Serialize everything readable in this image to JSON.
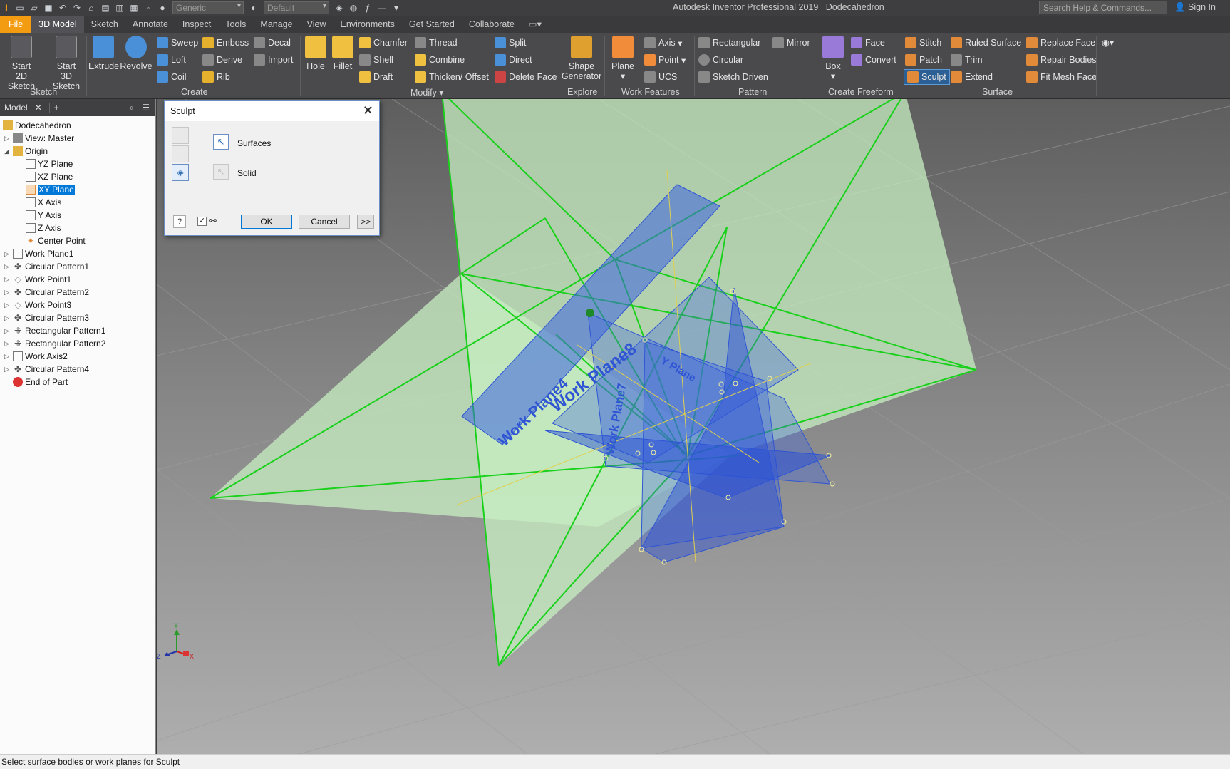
{
  "app": {
    "title": "Autodesk Inventor Professional 2019",
    "document": "Dodecahedron",
    "search_placeholder": "Search Help & Commands...",
    "sign_in": "Sign In",
    "material_combo": "Generic",
    "appearance_combo": "Default"
  },
  "tabs": [
    "File",
    "3D Model",
    "Sketch",
    "Annotate",
    "Inspect",
    "Tools",
    "Manage",
    "View",
    "Environments",
    "Get Started",
    "Collaborate"
  ],
  "ribbon": {
    "sketch": {
      "start2d_a": "Start",
      "start2d_b": "2D Sketch",
      "start3d_a": "Start",
      "start3d_b": "3D Sketch",
      "panel": "Sketch"
    },
    "create": {
      "extrude": "Extrude",
      "revolve": "Revolve",
      "sweep": "Sweep",
      "loft": "Loft",
      "coil": "Coil",
      "emboss": "Emboss",
      "derive": "Derive",
      "rib": "Rib",
      "decal": "Decal",
      "import": "Import",
      "panel": "Create"
    },
    "modify": {
      "hole": "Hole",
      "fillet": "Fillet",
      "chamfer": "Chamfer",
      "shell": "Shell",
      "draft": "Draft",
      "thread": "Thread",
      "combine": "Combine",
      "thicken": "Thicken/ Offset",
      "split": "Split",
      "direct": "Direct",
      "delete_face": "Delete Face",
      "panel": "Modify ▾"
    },
    "explore": {
      "shape_a": "Shape",
      "shape_b": "Generator",
      "panel": "Explore"
    },
    "work": {
      "plane": "Plane",
      "axis": "Axis",
      "point": "Point",
      "ucs": "UCS",
      "panel": "Work Features"
    },
    "pattern": {
      "rectangular": "Rectangular",
      "circular": "Circular",
      "sketch_driven": "Sketch Driven",
      "mirror": "Mirror",
      "panel": "Pattern"
    },
    "freeform": {
      "box": "Box",
      "face": "Face",
      "convert": "Convert",
      "panel": "Create Freeform"
    },
    "surface": {
      "stitch": "Stitch",
      "patch": "Patch",
      "sculpt": "Sculpt",
      "ruled": "Ruled Surface",
      "trim": "Trim",
      "extend": "Extend",
      "replace": "Replace Face",
      "repair": "Repair Bodies",
      "fit_mesh": "Fit Mesh Face",
      "panel": "Surface"
    }
  },
  "browser": {
    "tab": "Model",
    "items": [
      {
        "label": "Dodecahedron"
      },
      {
        "label": "View: Master"
      },
      {
        "label": "Origin"
      },
      {
        "label": "YZ Plane"
      },
      {
        "label": "XZ Plane"
      },
      {
        "label": "XY Plane"
      },
      {
        "label": "X Axis"
      },
      {
        "label": "Y Axis"
      },
      {
        "label": "Z Axis"
      },
      {
        "label": "Center Point"
      },
      {
        "label": "Work Plane1"
      },
      {
        "label": "Circular Pattern1"
      },
      {
        "label": "Work Point1"
      },
      {
        "label": "Circular Pattern2"
      },
      {
        "label": "Work Point3"
      },
      {
        "label": "Circular Pattern3"
      },
      {
        "label": "Rectangular Pattern1"
      },
      {
        "label": "Rectangular Pattern2"
      },
      {
        "label": "Work Axis2"
      },
      {
        "label": "Circular Pattern4"
      },
      {
        "label": "End of Part"
      }
    ]
  },
  "dialog": {
    "title": "Sculpt",
    "surfaces": "Surfaces",
    "solid": "Solid",
    "ok": "OK",
    "cancel": "Cancel",
    "more": ">>"
  },
  "viewport": {
    "labels": [
      "Work Plane4",
      "Work Plane8",
      "Work Plane7",
      "Y Plane"
    ],
    "triad": {
      "x": "X",
      "y": "Y",
      "z": "Z"
    }
  },
  "status": "Select surface bodies or work planes for Sculpt"
}
